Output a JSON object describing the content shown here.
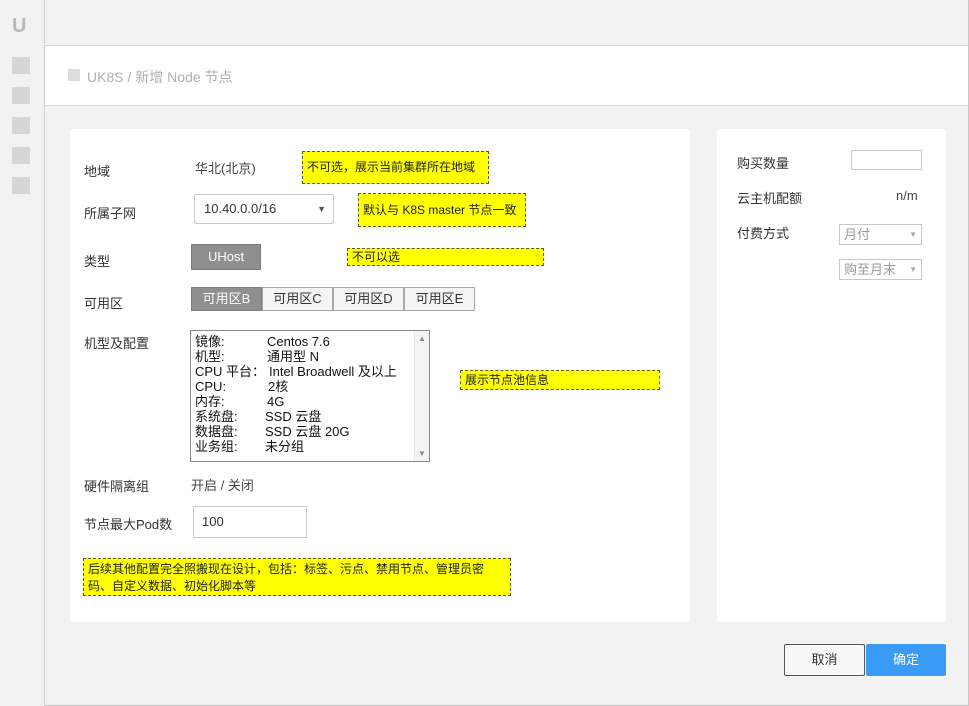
{
  "sidebar": {
    "logo": "U"
  },
  "header": {
    "title": "UK8S / 新增 Node 节点"
  },
  "form": {
    "region": {
      "label": "地域",
      "value": "华北(北京)",
      "note": "不可选，展示当前集群所在地域"
    },
    "subnet": {
      "label": "所属子网",
      "value": "10.40.0.0/16",
      "note": "默认与 K8S master 节点一致"
    },
    "type": {
      "label": "类型",
      "button": "UHost",
      "note": "不可以选"
    },
    "zone": {
      "label": "可用区",
      "options": [
        "可用区B",
        "可用区C",
        "可用区D",
        "可用区E"
      ]
    },
    "config": {
      "label": "机型及配置",
      "rows": [
        {
          "key": "镜像:",
          "value": "Centos 7.6"
        },
        {
          "key": "机型:",
          "value": "通用型 N"
        },
        {
          "key": "CPU 平台：",
          "value": "Intel Broadwell 及以上"
        },
        {
          "key": "CPU:",
          "value": "2核"
        },
        {
          "key": "内存:",
          "value": "4G"
        },
        {
          "key": "系统盘:",
          "value": "SSD 云盘"
        },
        {
          "key": "数据盘:",
          "value": "SSD 云盘 20G"
        },
        {
          "key": "业务组:",
          "value": "未分组"
        }
      ],
      "note": "展示节点池信息"
    },
    "isolation": {
      "label": "硬件隔离组",
      "value": "开启 / 关闭"
    },
    "max_pod": {
      "label": "节点最大Pod数",
      "value": "100"
    },
    "footer_note": "后续其他配置完全照搬现在设计，包括：标签、污点、禁用节点、管理员密码、自定义数据、初始化脚本等"
  },
  "purchase": {
    "quantity_label": "购买数量",
    "quota_label": "云主机配额",
    "quota_value": "n/m",
    "billing_label": "付费方式",
    "billing_value": "月付",
    "duration_value": "购至月末"
  },
  "actions": {
    "cancel": "取消",
    "confirm": "确定"
  }
}
